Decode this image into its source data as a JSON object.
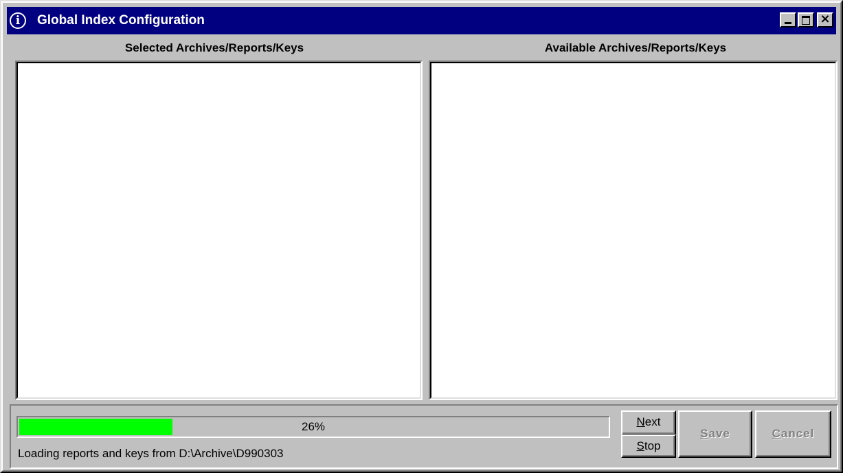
{
  "window": {
    "title": "Global Index Configuration",
    "title_icon": "info-icon",
    "controls": {
      "minimize": "minimize-icon",
      "maximize": "maximize-icon",
      "close": "close-icon"
    }
  },
  "panes": {
    "selected": {
      "header": "Selected Archives/Reports/Keys",
      "items": []
    },
    "available": {
      "header": "Available Archives/Reports/Keys",
      "items": []
    }
  },
  "progress": {
    "percent": 26,
    "label": "26%",
    "fill_color": "#00ff00"
  },
  "status": {
    "text": "Loading reports and keys from D:\\Archive\\D990303"
  },
  "buttons": {
    "next": {
      "label_first": "N",
      "label_rest": "ext",
      "enabled": true
    },
    "stop": {
      "label_first": "S",
      "label_rest": "top",
      "enabled": true
    },
    "save": {
      "label_first": "S",
      "label_rest": "ave",
      "enabled": false
    },
    "cancel": {
      "label_first": "C",
      "label_rest": "ancel",
      "enabled": false
    }
  }
}
